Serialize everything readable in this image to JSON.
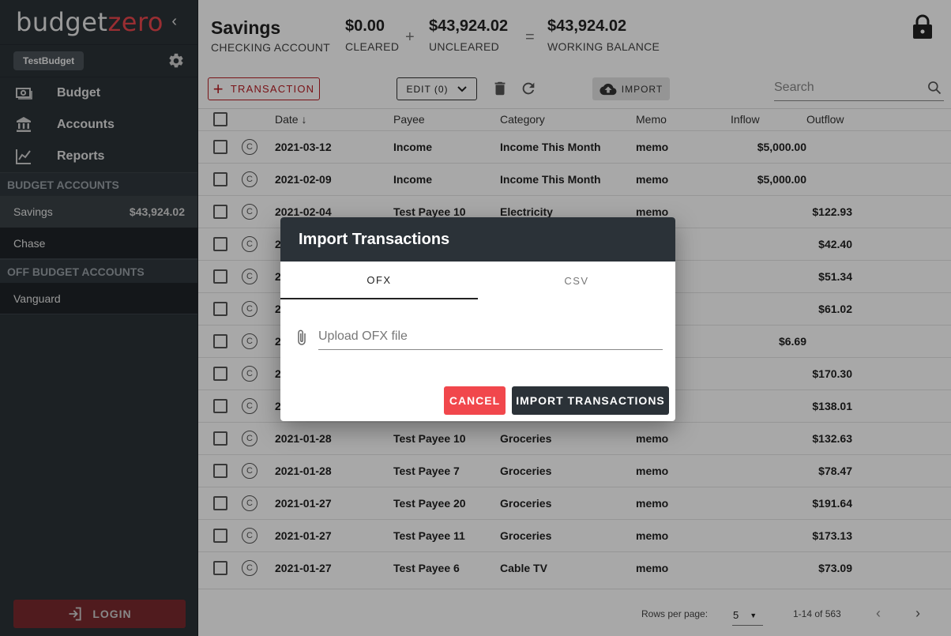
{
  "sidebar": {
    "brand_part1": "budget",
    "brand_part2": "zero",
    "collapse_glyph": "‹",
    "budget_name": "TestBudget",
    "nav": [
      {
        "label": "Budget",
        "icon": "money-icon"
      },
      {
        "label": "Accounts",
        "icon": "bank-icon"
      },
      {
        "label": "Reports",
        "icon": "chart-line-icon"
      }
    ],
    "budget_accounts_header": "BUDGET ACCOUNTS",
    "budget_accounts": [
      {
        "name": "Savings",
        "balance": "$43,924.02",
        "active": true
      },
      {
        "name": "Chase",
        "balance": ""
      }
    ],
    "off_budget_header": "OFF BUDGET ACCOUNTS",
    "off_budget_accounts": [
      {
        "name": "Vanguard",
        "balance": ""
      }
    ],
    "login_label": "LOGIN"
  },
  "header": {
    "account_name": "Savings",
    "account_type": "CHECKING ACCOUNT",
    "cleared_value": "$0.00",
    "cleared_label": "CLEARED",
    "plus": "+",
    "uncleared_value": "$43,924.02",
    "uncleared_label": "UNCLEARED",
    "equals": "=",
    "working_value": "$43,924.02",
    "working_label": "WORKING BALANCE"
  },
  "toolbar": {
    "add_label": "TRANSACTION",
    "plus_glyph": "+",
    "edit_label": "EDIT (0)",
    "import_label": "IMPORT",
    "search_placeholder": "Search"
  },
  "table": {
    "columns": {
      "date": "Date",
      "payee": "Payee",
      "category": "Category",
      "memo": "Memo",
      "inflow": "Inflow",
      "outflow": "Outflow"
    },
    "sort_glyph": "↓",
    "cleared_glyph": "C",
    "rows": [
      {
        "date": "2021-03-12",
        "payee": "Income",
        "category": "Income This Month",
        "memo": "memo",
        "inflow": "$5,000.00",
        "outflow": ""
      },
      {
        "date": "2021-02-09",
        "payee": "Income",
        "category": "Income This Month",
        "memo": "memo",
        "inflow": "$5,000.00",
        "outflow": ""
      },
      {
        "date": "2021-02-04",
        "payee": "Test Payee 10",
        "category": "Electricity",
        "memo": "memo",
        "inflow": "",
        "outflow": "$122.93"
      },
      {
        "date": "2",
        "payee": "",
        "category": "",
        "memo": "",
        "inflow": "",
        "outflow": "$42.40"
      },
      {
        "date": "2",
        "payee": "",
        "category": "",
        "memo": "",
        "inflow": "",
        "outflow": "$51.34"
      },
      {
        "date": "2",
        "payee": "",
        "category": "",
        "memo": "",
        "inflow": "",
        "outflow": "$61.02"
      },
      {
        "date": "2",
        "payee": "",
        "category": "",
        "memo": "",
        "inflow": "$6.69",
        "outflow": ""
      },
      {
        "date": "2",
        "payee": "",
        "category": "",
        "memo": "",
        "inflow": "",
        "outflow": "$170.30"
      },
      {
        "date": "2",
        "payee": "",
        "category": "",
        "memo": "",
        "inflow": "",
        "outflow": "$138.01"
      },
      {
        "date": "2021-01-28",
        "payee": "Test Payee 10",
        "category": "Groceries",
        "memo": "memo",
        "inflow": "",
        "outflow": "$132.63"
      },
      {
        "date": "2021-01-28",
        "payee": "Test Payee 7",
        "category": "Groceries",
        "memo": "memo",
        "inflow": "",
        "outflow": "$78.47"
      },
      {
        "date": "2021-01-27",
        "payee": "Test Payee 20",
        "category": "Groceries",
        "memo": "memo",
        "inflow": "",
        "outflow": "$191.64"
      },
      {
        "date": "2021-01-27",
        "payee": "Test Payee 11",
        "category": "Groceries",
        "memo": "memo",
        "inflow": "",
        "outflow": "$173.13"
      },
      {
        "date": "2021-01-27",
        "payee": "Test Payee 6",
        "category": "Cable TV",
        "memo": "memo",
        "inflow": "",
        "outflow": "$73.09"
      }
    ]
  },
  "pagination": {
    "rows_per_page_label": "Rows per page:",
    "rows_per_page_value": "5",
    "dropdown_glyph": "▼",
    "range": "1-14 of 563",
    "prev_glyph": "‹",
    "next_glyph": "›"
  },
  "dialog": {
    "title": "Import Transactions",
    "tabs": [
      {
        "label": "OFX",
        "active": true
      },
      {
        "label": "CSV",
        "active": false
      }
    ],
    "upload_placeholder": "Upload OFX file",
    "cancel_label": "CANCEL",
    "import_label": "IMPORT TRANSACTIONS"
  },
  "colors": {
    "brand_accent": "#e8464d",
    "sidebar_bg": "#2b3238",
    "cancel_bg": "#f1474c",
    "primary_bg": "#2b3238"
  }
}
